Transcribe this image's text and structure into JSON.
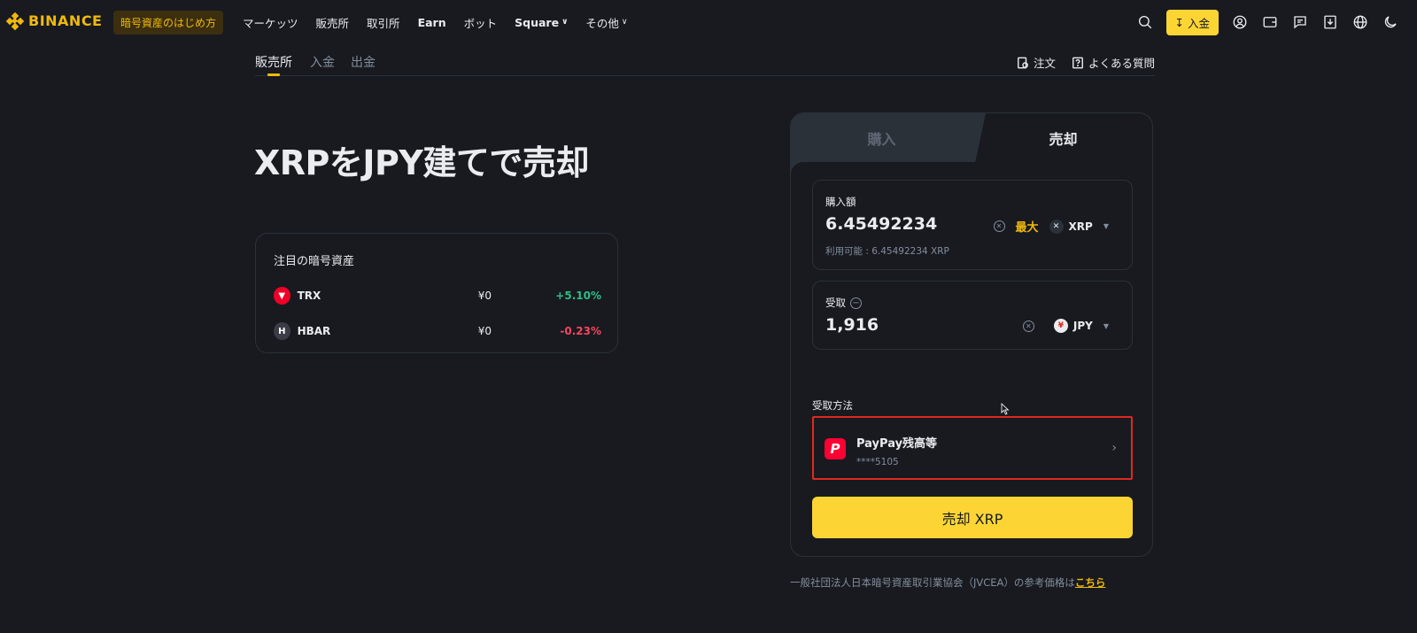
{
  "brand": {
    "name": "BINANCE",
    "color": "#f0b90b"
  },
  "nav": {
    "highlight": "暗号資産のはじめ方",
    "items": [
      {
        "label": "マーケッツ"
      },
      {
        "label": "販売所"
      },
      {
        "label": "取引所"
      },
      {
        "label": "Earn"
      },
      {
        "label": "ボット"
      },
      {
        "label": "Square"
      },
      {
        "label": "その他"
      }
    ],
    "deposit_label": "入金"
  },
  "subtabs": {
    "items": [
      "販売所",
      "入金",
      "出金"
    ],
    "active": "販売所",
    "order_label": "注文",
    "faq_label": "よくある質問"
  },
  "hero": {
    "title": "XRPをJPY建てで売却"
  },
  "watchlist": {
    "title": "注目の暗号資産",
    "rows": [
      {
        "symbol": "TRX",
        "price": "¥0",
        "change": "+5.10%",
        "direction": "up",
        "icon_color": "#ef0027"
      },
      {
        "symbol": "HBAR",
        "price": "¥0",
        "change": "-0.23%",
        "direction": "down",
        "icon_color": "#3a3d45"
      }
    ]
  },
  "panel": {
    "tabs": {
      "buy": "購入",
      "sell": "売却",
      "active": "sell"
    },
    "amount": {
      "label": "購入額",
      "value": "6.45492234",
      "max_label": "最大",
      "currency": "XRP",
      "available": "利用可能 : 6.45492234 XRP"
    },
    "receive": {
      "label": "受取",
      "value": "1,916",
      "currency": "JPY"
    },
    "method": {
      "label": "受取方法",
      "name": "PayPay残高等",
      "account": "****5105",
      "icon_letter": "P"
    },
    "submit_label": "売却 XRP"
  },
  "footer": {
    "reference_text": "一般社団法人日本暗号資産取引業協会（JVCEA）の参考価格は",
    "reference_link": "こちら"
  },
  "colors": {
    "background": "#181a20",
    "accent": "#fcd535",
    "up": "#2ebd85",
    "down": "#f6465d",
    "highlight_border": "#e0281e"
  }
}
